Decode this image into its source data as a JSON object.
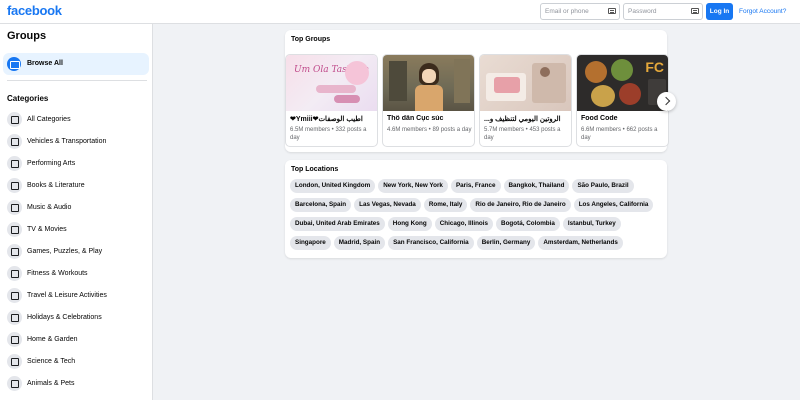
{
  "header": {
    "logo": "facebook",
    "email_placeholder": "Email or phone",
    "password_placeholder": "Password",
    "login_label": "Log In",
    "forgot_label": "Forgot Account?"
  },
  "sidebar": {
    "title": "Groups",
    "browse_all": "Browse All",
    "categories_title": "Categories",
    "categories": [
      {
        "label": "All Categories",
        "icon": "grid-icon"
      },
      {
        "label": "Vehicles & Transportation",
        "icon": "car-icon"
      },
      {
        "label": "Performing Arts",
        "icon": "theater-masks-icon"
      },
      {
        "label": "Books & Literature",
        "icon": "book-icon"
      },
      {
        "label": "Music & Audio",
        "icon": "music-note-icon"
      },
      {
        "label": "TV & Movies",
        "icon": "tv-icon"
      },
      {
        "label": "Games, Puzzles, & Play",
        "icon": "game-controller-icon"
      },
      {
        "label": "Fitness & Workouts",
        "icon": "dumbbell-icon"
      },
      {
        "label": "Travel & Leisure Activities",
        "icon": "airplane-icon"
      },
      {
        "label": "Holidays & Celebrations",
        "icon": "party-icon"
      },
      {
        "label": "Home & Garden",
        "icon": "home-icon"
      },
      {
        "label": "Science & Tech",
        "icon": "flask-icon"
      },
      {
        "label": "Animals & Pets",
        "icon": "paw-icon"
      }
    ]
  },
  "top_groups": {
    "title": "Top Groups",
    "groups": [
      {
        "name": "❤Ymiii❤اطيب الوصفات",
        "meta": "6.5M members • 332 posts a day",
        "thumb_text": "Um Ola Tasbaan"
      },
      {
        "name": "Thổ dân Cục súc",
        "meta": "4.6M members • 89 posts a day"
      },
      {
        "name": "الروتين اليومي لتنظيف و...",
        "meta": "5.7M members • 453 posts a day"
      },
      {
        "name": "Food Code",
        "meta": "6.6M members • 662 posts a day",
        "thumb_text": "FC"
      }
    ]
  },
  "top_locations": {
    "title": "Top Locations",
    "locations": [
      "London, United Kingdom",
      "New York, New York",
      "Paris, France",
      "Bangkok, Thailand",
      "São Paulo, Brazil",
      "Barcelona, Spain",
      "Las Vegas, Nevada",
      "Rome, Italy",
      "Rio de Janeiro, Rio de Janeiro",
      "Los Angeles, California",
      "Dubai, United Arab Emirates",
      "Hong Kong",
      "Chicago, Illinois",
      "Bogotá, Colombia",
      "Istanbul, Turkey",
      "Singapore",
      "Madrid, Spain",
      "San Francisco, California",
      "Berlin, Germany",
      "Amsterdam, Netherlands"
    ]
  },
  "colors": {
    "brand": "#1877f2",
    "page_bg": "#f0f2f5",
    "chip_bg": "#e4e6eb"
  }
}
